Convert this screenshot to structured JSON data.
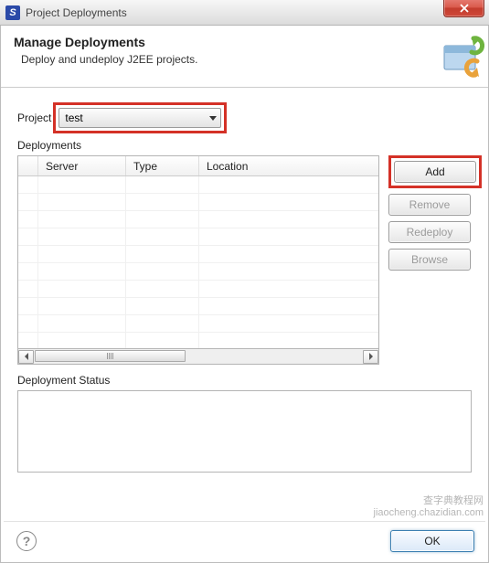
{
  "window": {
    "title": "Project Deployments"
  },
  "header": {
    "title": "Manage Deployments",
    "subtitle": "Deploy and undeploy J2EE projects."
  },
  "project": {
    "label": "Project",
    "selected": "test"
  },
  "deployments": {
    "label": "Deployments",
    "columns": {
      "server": "Server",
      "type": "Type",
      "location": "Location"
    },
    "rows": []
  },
  "buttons": {
    "add": "Add",
    "remove": "Remove",
    "redeploy": "Redeploy",
    "browse": "Browse",
    "ok": "OK"
  },
  "status": {
    "label": "Deployment Status"
  },
  "watermark": {
    "line1": "查字典教程网",
    "line2": "jiaocheng.chazidian.com"
  }
}
